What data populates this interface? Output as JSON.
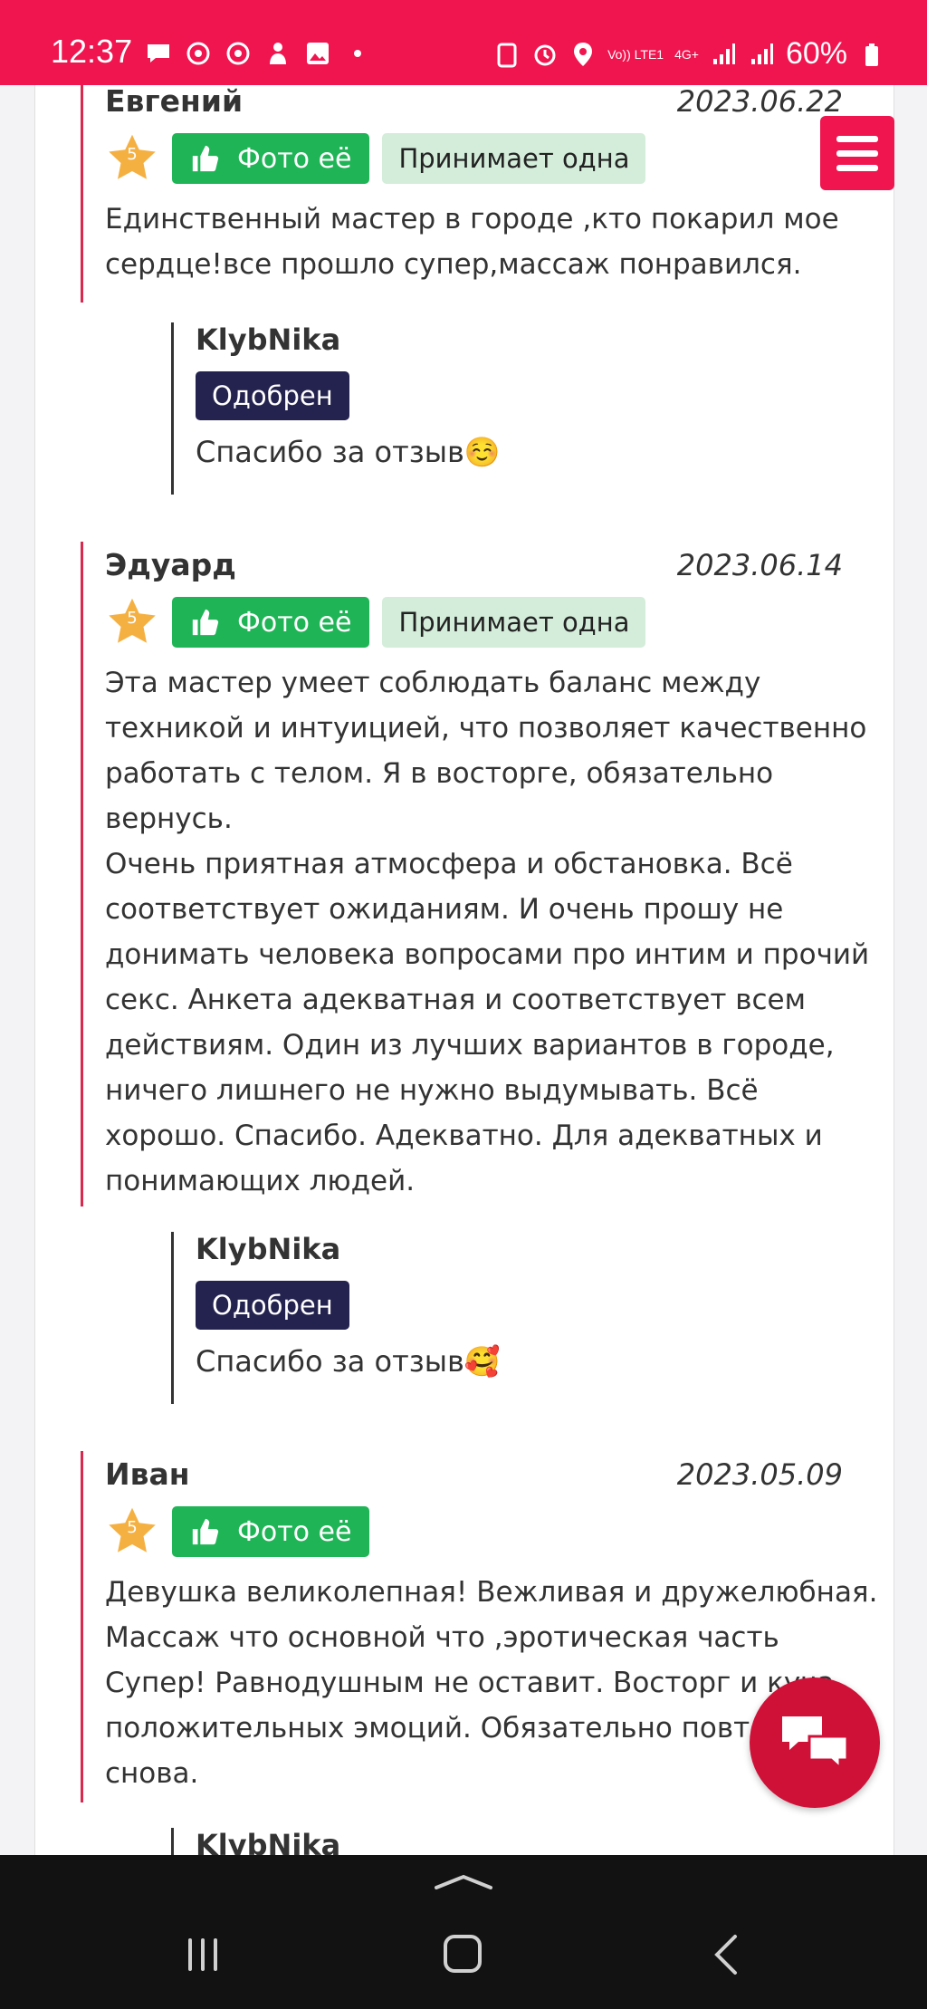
{
  "status_bar": {
    "time": "12:37",
    "network": "4G+",
    "volte": "Vo)) LTE1",
    "battery": "60%"
  },
  "reviews": [
    {
      "name": "Евгений",
      "date": "2023.06.22",
      "rating": "5",
      "photo_label": "Фото её",
      "accepts_label": "Принимает одна",
      "text": "Единственный мастер в городе ,кто покарил мое сердце!все прошло супер,массаж понравился.",
      "reply": {
        "name": "KlybNika",
        "status": "Одобрен",
        "text": "Спасибо за отзыв☺️"
      }
    },
    {
      "name": "Эдуард",
      "date": "2023.06.14",
      "rating": "5",
      "photo_label": "Фото её",
      "accepts_label": "Принимает одна",
      "text": "Эта мастер умеет соблюдать баланс между техникой и интуицией, что позволяет качественно работать с телом. Я в восторге, обязательно вернусь.\nОчень приятная атмосфера и обстановка. Всё соответствует ожиданиям. И очень прошу не донимать человека вопросами про интим и прочий секс. Анкета адекватная и соответствует всем действиям. Один из лучших вариантов в городе, ничего лишнего не нужно выдумывать. Всё хорошо. Спасибо. Адекватно. Для адекватных и понимающих людей.",
      "reply": {
        "name": "KlybNika",
        "status": "Одобрен",
        "text": "Спасибо за отзыв🥰"
      }
    },
    {
      "name": "Иван",
      "date": "2023.05.09",
      "rating": "5",
      "photo_label": "Фото её",
      "text": "Девушка великолепная! Вежливая и дружелюбная. Массаж что основной что ,эротическая часть Супер! Равнодушным не оставит. Восторг и куча положительных эмоций. Обязательно повторю снова.",
      "reply": {
        "name": "KlybNika"
      }
    }
  ],
  "colors": {
    "brand": "#f0144f",
    "photo_green": "#1fb556",
    "approved_navy": "#24234f",
    "star": "#f5b042"
  }
}
